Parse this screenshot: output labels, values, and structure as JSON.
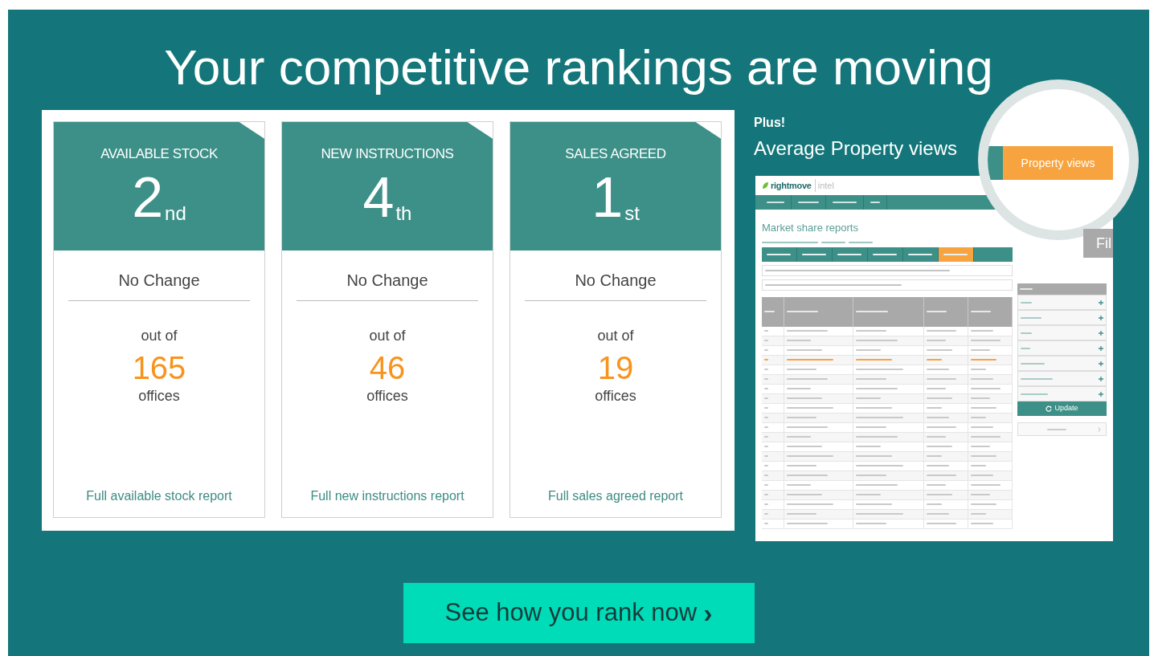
{
  "headline": "Your competitive rankings are moving",
  "rankings": [
    {
      "title": "AVAILABLE STOCK",
      "rank": "2",
      "suffix": "nd",
      "change": "No Change",
      "out_of": "out of",
      "total": "165",
      "unit": "offices",
      "link": "Full available stock report"
    },
    {
      "title": "NEW INSTRUCTIONS",
      "rank": "4",
      "suffix": "th",
      "change": "No Change",
      "out_of": "out of",
      "total": "46",
      "unit": "offices",
      "link": "Full new instructions report"
    },
    {
      "title": "SALES AGREED",
      "rank": "1",
      "suffix": "st",
      "change": "No Change",
      "out_of": "out of",
      "total": "19",
      "unit": "offices",
      "link": "Full sales agreed report"
    }
  ],
  "plus": {
    "label": "Plus!",
    "title": "Average Property views"
  },
  "inset": {
    "logo": {
      "brand": "rightmove",
      "product": "intel"
    },
    "magnified_tab": "Property views",
    "filter_button": "Fil",
    "page_title": "Market share reports",
    "tabs": [
      {
        "selected": false
      },
      {
        "selected": false
      },
      {
        "selected": false
      },
      {
        "selected": false
      },
      {
        "selected": false
      },
      {
        "selected": true
      }
    ],
    "rows": [
      {
        "selected": false
      },
      {
        "selected": false
      },
      {
        "selected": false
      },
      {
        "selected": true
      },
      {
        "selected": false
      },
      {
        "selected": false
      },
      {
        "selected": false
      },
      {
        "selected": false
      },
      {
        "selected": false
      },
      {
        "selected": false
      },
      {
        "selected": false
      },
      {
        "selected": false
      },
      {
        "selected": false
      },
      {
        "selected": false
      },
      {
        "selected": false
      },
      {
        "selected": false
      },
      {
        "selected": false
      },
      {
        "selected": false
      },
      {
        "selected": false
      },
      {
        "selected": false
      },
      {
        "selected": false
      }
    ],
    "update": "Update"
  },
  "cta": {
    "label": "See how you rank now",
    "chevron": "›"
  }
}
